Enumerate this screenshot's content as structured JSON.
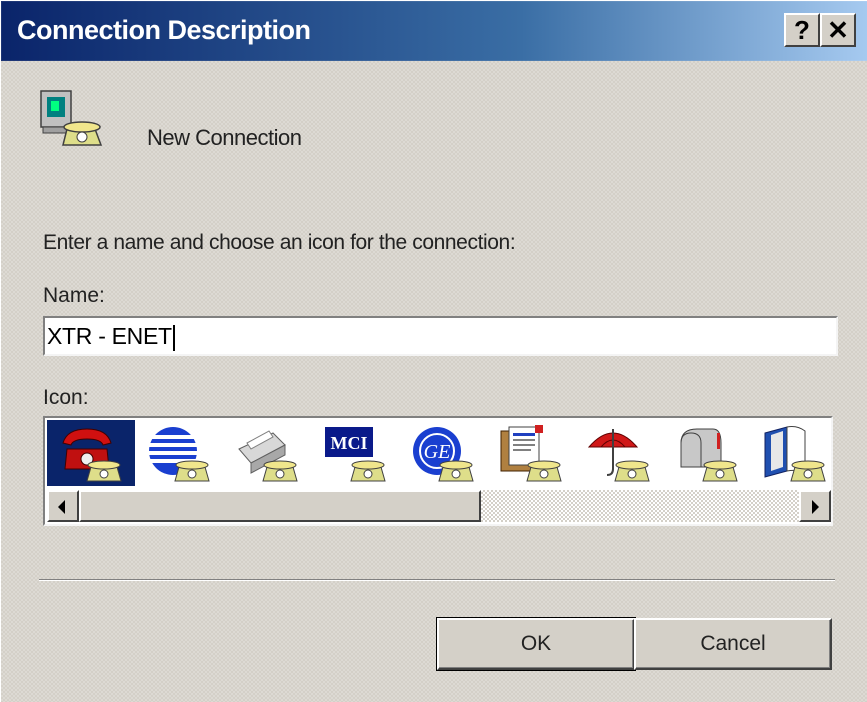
{
  "window": {
    "title": "Connection Description",
    "help_label": "?",
    "close_label": "✕"
  },
  "header": {
    "connection_name": "New Connection",
    "icon": "modem-phone-icon"
  },
  "instruction": "Enter a name and choose an icon for the connection:",
  "name_field": {
    "label": "Name:",
    "value": "XTR - ENET"
  },
  "icon_field": {
    "label": "Icon:",
    "selected_index": 0,
    "icons": [
      "red-telephone-icon",
      "globe-icon",
      "fax-machine-icon",
      "mci-icon",
      "ge-logo-icon",
      "documents-icon",
      "umbrella-icon",
      "mailbox-icon",
      "book-icon"
    ],
    "mci_text": "MCI",
    "ge_text": "GE"
  },
  "buttons": {
    "ok_label": "OK",
    "cancel_label": "Cancel"
  },
  "colors": {
    "title_gradient_start": "#0a246a",
    "title_gradient_end": "#a6caf0",
    "dialog_face": "#d4d0c8",
    "selection": "#0a246a"
  }
}
